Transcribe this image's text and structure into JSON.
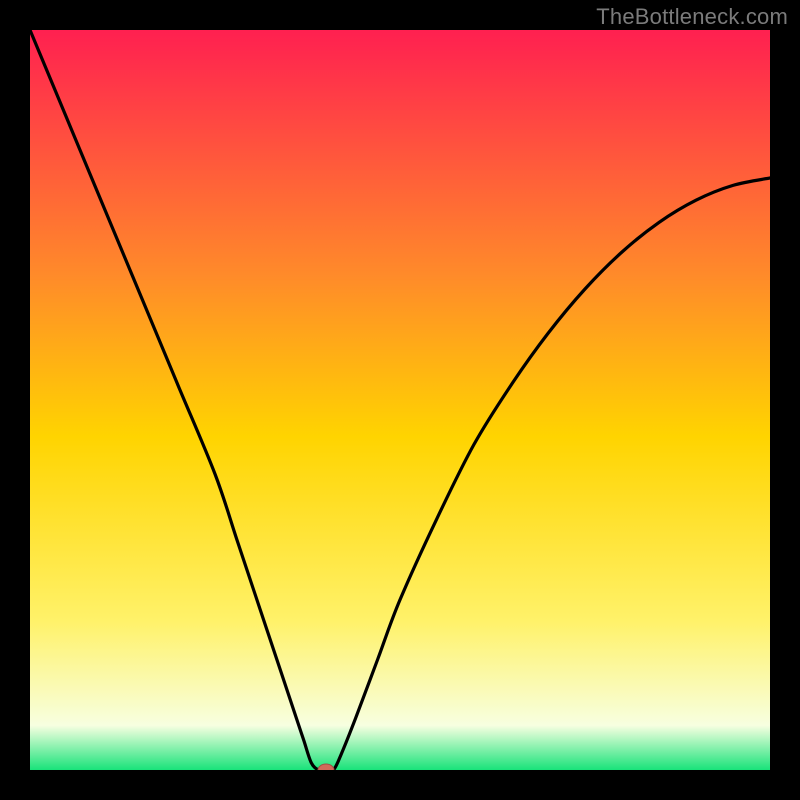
{
  "watermark": "TheBottleneck.com",
  "colors": {
    "black": "#000000",
    "curve": "#000000",
    "marker_fill": "#d06a5a",
    "marker_stroke": "#9c5146",
    "grad_top": "#ff2050",
    "grad_mid_upper": "#ff8a2a",
    "grad_mid": "#ffd400",
    "grad_mid_lower": "#fff26a",
    "grad_low": "#f7ffe0",
    "grad_bottom": "#19e37a"
  },
  "chart_data": {
    "type": "line",
    "title": "",
    "xlabel": "",
    "ylabel": "",
    "xlim": [
      0,
      100
    ],
    "ylim": [
      0,
      100
    ],
    "x": [
      0,
      5,
      10,
      15,
      20,
      25,
      28,
      31,
      34,
      36,
      37,
      38,
      39,
      40,
      41,
      42,
      44,
      47,
      50,
      55,
      60,
      65,
      70,
      75,
      80,
      85,
      90,
      95,
      100
    ],
    "values": [
      100,
      88,
      76,
      64,
      52,
      40,
      31,
      22,
      13,
      7,
      4,
      1,
      0,
      0,
      0,
      2,
      7,
      15,
      23,
      34,
      44,
      52,
      59,
      65,
      70,
      74,
      77,
      79,
      80
    ],
    "marker": {
      "x": 40,
      "y": 0
    },
    "annotations": []
  }
}
